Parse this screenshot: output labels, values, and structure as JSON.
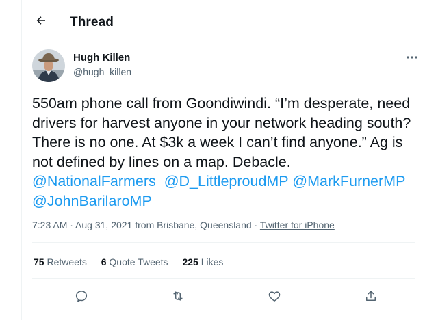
{
  "header": {
    "title": "Thread",
    "back_icon": "arrow-left-icon"
  },
  "author": {
    "name": "Hugh Killen",
    "handle": "@hugh_killen",
    "avatar_icon": "avatar-photo"
  },
  "tweet": {
    "text_1": "550am phone call from Goondiwindi. “I’m desperate, need drivers for harvest anyone in your network heading south? There is no one. At $3k a week I can’t find anyone.” Ag is not defined by lines on a map. Debacle. ",
    "mention_1": "@NationalFarmers",
    "space_1": "  ",
    "mention_2": "@D_LittleproudMP",
    "space_2": " ",
    "mention_3": "@MarkFurnerMP",
    "space_3": " ",
    "mention_4": "@JohnBarilaroMP"
  },
  "meta": {
    "time": "7:23 AM",
    "separator": " · ",
    "date_location": "Aug 31, 2021 from Brisbane, Queensland",
    "source": "Twitter for iPhone"
  },
  "stats": {
    "retweets_count": "75",
    "retweets_label": "Retweets",
    "quotes_count": "6",
    "quotes_label": "Quote Tweets",
    "likes_count": "225",
    "likes_label": "Likes"
  },
  "actions": [
    "reply-icon",
    "retweet-icon",
    "like-icon",
    "share-icon"
  ],
  "colors": {
    "accent": "#1d9bf0",
    "text": "#0f1419",
    "muted": "#536471",
    "divider": "#eff3f4"
  }
}
